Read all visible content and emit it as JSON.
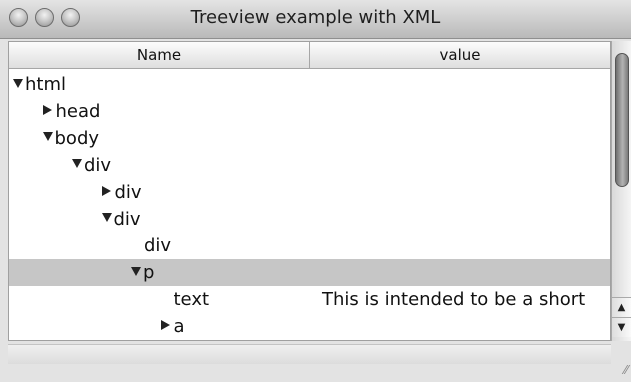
{
  "window": {
    "title": "Treeview example with XML",
    "buttons": [
      "close",
      "minimize",
      "zoom"
    ]
  },
  "tree": {
    "columns": [
      {
        "label": "Name"
      },
      {
        "label": "value"
      }
    ],
    "rows": [
      {
        "name": "html",
        "expander": "expanded",
        "depth": 0,
        "value": "",
        "selected": false
      },
      {
        "name": "head",
        "expander": "collapsed",
        "depth": 1,
        "value": "",
        "selected": false
      },
      {
        "name": "body",
        "expander": "expanded",
        "depth": 1,
        "value": "",
        "selected": false
      },
      {
        "name": "div",
        "expander": "expanded",
        "depth": 2,
        "value": "",
        "selected": false
      },
      {
        "name": "div",
        "expander": "collapsed",
        "depth": 3,
        "value": "",
        "selected": false
      },
      {
        "name": "div",
        "expander": "expanded",
        "depth": 3,
        "value": "",
        "selected": false
      },
      {
        "name": "div",
        "expander": "none",
        "depth": 4,
        "value": "",
        "selected": false
      },
      {
        "name": "p",
        "expander": "expanded",
        "depth": 4,
        "value": "",
        "selected": true
      },
      {
        "name": "text",
        "expander": "none",
        "depth": 5,
        "value": "This is intended to be a short",
        "selected": false
      },
      {
        "name": "a",
        "expander": "collapsed",
        "depth": 5,
        "value": "",
        "selected": false
      }
    ]
  },
  "scrollbar": {
    "up_arrow": "▲",
    "down_arrow": "▼"
  },
  "colors": {
    "selected_row": "#c6c6c6",
    "titlebar_top": "#e4e4e4",
    "titlebar_bottom": "#b9b9b9"
  },
  "icons": {
    "expanded": "triangle-down-icon",
    "collapsed": "triangle-right-icon",
    "resize": "resize-grip-icon"
  }
}
